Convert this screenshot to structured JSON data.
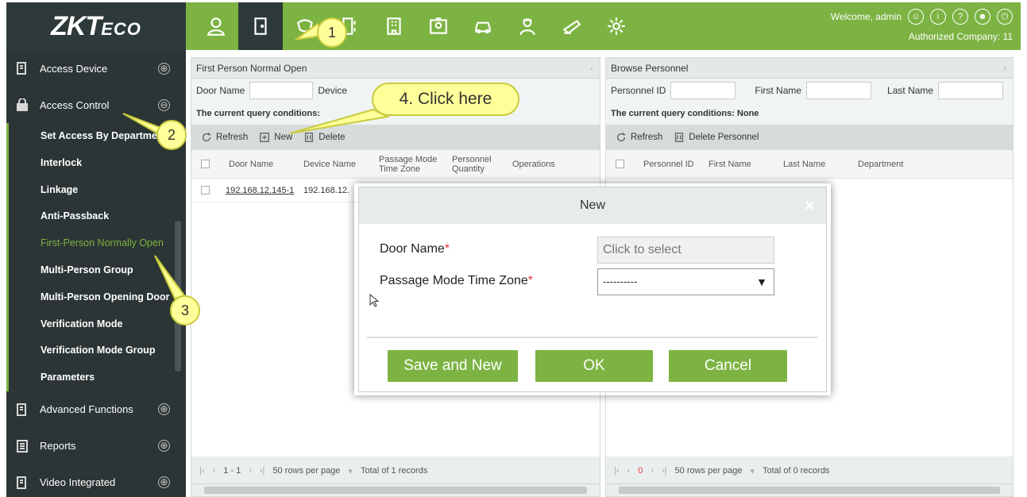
{
  "brand": {
    "logo_main": "ZKT",
    "logo_sub": "ECO"
  },
  "header": {
    "welcome": "Welcome, admin",
    "company": "Authorized Company: 11",
    "nav_icons": [
      "person-icon",
      "door-icon",
      "mask-icon",
      "turnstile-icon",
      "building-icon",
      "badge-icon",
      "car-icon",
      "guard-icon",
      "patrol-icon",
      "gear-icon"
    ]
  },
  "sidebar": {
    "sections": [
      {
        "label": "Access Device",
        "toggle": "⊕"
      },
      {
        "label": "Access Control",
        "toggle": "⊖"
      }
    ],
    "sub_items": [
      "Set Access By Department",
      "Interlock",
      "Linkage",
      "Anti-Passback",
      "First-Person Normally Open",
      "Multi-Person Group",
      "Multi-Person Opening Door",
      "Verification Mode",
      "Verification Mode Group",
      "Parameters"
    ],
    "bottom_sections": [
      {
        "label": "Advanced Functions",
        "toggle": "⊕"
      },
      {
        "label": "Reports",
        "toggle": "⊕"
      },
      {
        "label": "Video Integrated",
        "toggle": "⊕"
      }
    ]
  },
  "left_panel": {
    "title": "First Person Normal Open",
    "filter_door": "Door Name",
    "filter_device": "Device",
    "conditions": "The current query conditions:",
    "toolbar": {
      "refresh": "Refresh",
      "new": "New",
      "delete": "Delete"
    },
    "columns": [
      "Door Name",
      "Device Name",
      "Passage Mode Time Zone",
      "Personnel Quantity",
      "Operations"
    ],
    "rows": [
      {
        "door": "192.168.12.145-1",
        "device": "192.168.12."
      }
    ],
    "pager": {
      "range": "1 - 1",
      "rows_per_page": "50 rows per page",
      "total": "Total of 1 records"
    }
  },
  "right_panel": {
    "title": "Browse Personnel",
    "filter_id": "Personnel ID",
    "filter_first": "First Name",
    "filter_last": "Last Name",
    "conditions": "The current query conditions: None",
    "toolbar": {
      "refresh": "Refresh",
      "delete": "Delete Personnel"
    },
    "columns": [
      "Personnel ID",
      "First Name",
      "Last Name",
      "Department"
    ],
    "pager": {
      "page": "0",
      "rows_per_page": "50 rows per page",
      "total": "Total of 0 records"
    }
  },
  "modal": {
    "title": "New",
    "close": "×",
    "door_label": "Door Name",
    "door_placeholder": "Click to select",
    "tz_label": "Passage Mode Time Zone",
    "tz_value": "----------",
    "required_mark": "*",
    "btn_save_new": "Save and New",
    "btn_ok": "OK",
    "btn_cancel": "Cancel"
  },
  "callouts": {
    "c1": "1",
    "c2": "2",
    "c3": "3",
    "c4": "4. Click here"
  },
  "colors": {
    "accent": "#7cb342",
    "dark": "#2c3535",
    "callout": "#ffff99"
  }
}
